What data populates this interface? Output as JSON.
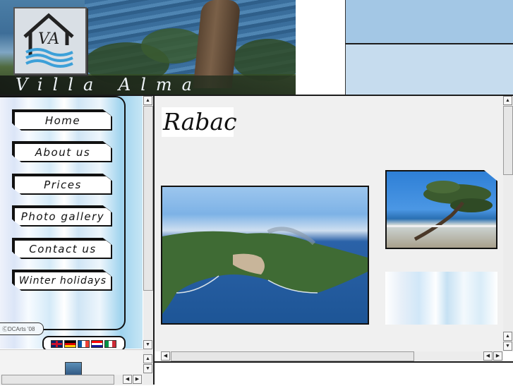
{
  "header": {
    "site_title": "Villa Alma",
    "logo_monogram": "VA",
    "logo_icon": "house-waves-logo"
  },
  "nav": {
    "items": [
      {
        "label": "Home"
      },
      {
        "label": "About us"
      },
      {
        "label": "Prices"
      },
      {
        "label": "Photo gallery"
      },
      {
        "label": "Contact us"
      },
      {
        "label": "Winter holidays"
      }
    ],
    "copyright": "ⒸDCArts '08",
    "languages": [
      "english-flag-icon",
      "german-flag-icon",
      "french-flag-icon",
      "croatian-flag-icon",
      "italian-flag-icon"
    ]
  },
  "main": {
    "title": "Rabac"
  },
  "colors": {
    "top_right_dark": "#a3c7e5",
    "top_right_light": "#c6dcee",
    "frame_border": "#1c1c1c",
    "main_bg": "#f0f0f0"
  }
}
